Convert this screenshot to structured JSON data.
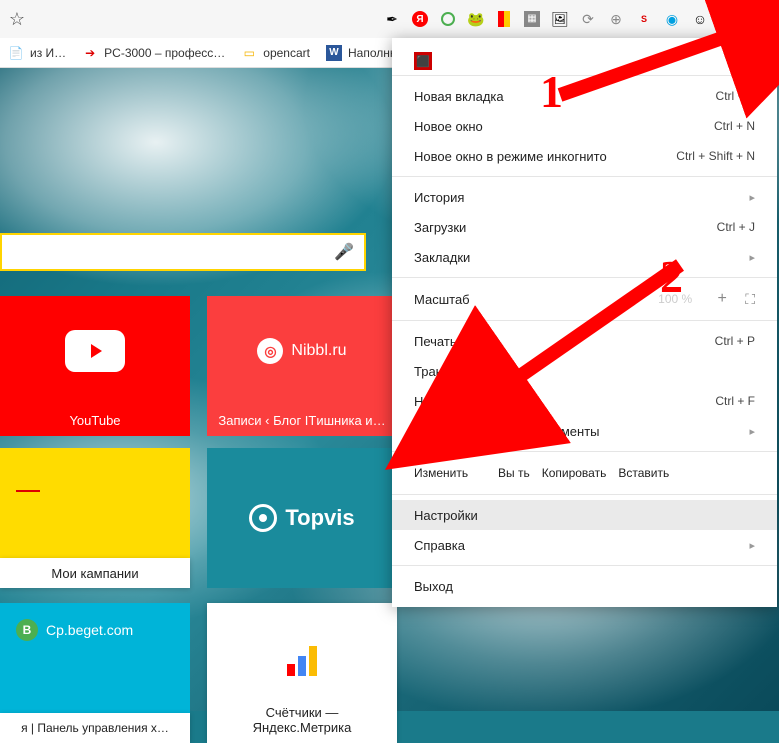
{
  "bookmarks": [
    {
      "label": "из И…"
    },
    {
      "label": "PC-3000 – професс…"
    },
    {
      "label": "opencart"
    },
    {
      "label": "Наполню"
    }
  ],
  "menu": {
    "new_tab": {
      "label": "Новая вкладка",
      "shortcut": "Ctrl + T"
    },
    "new_window": {
      "label": "Новое окно",
      "shortcut": "Ctrl + N"
    },
    "incognito": {
      "label": "Новое окно в режиме инкогнито",
      "shortcut": "Ctrl + Shift + N"
    },
    "history": {
      "label": "История"
    },
    "downloads": {
      "label": "Загрузки",
      "shortcut": "Ctrl + J"
    },
    "bookmarks": {
      "label": "Закладки"
    },
    "zoom": {
      "label": "Масштаб",
      "value": "100 %"
    },
    "print": {
      "label": "Печать...",
      "shortcut": "Ctrl + P"
    },
    "cast": {
      "label": "Трансляция..."
    },
    "find": {
      "label": "Найти...",
      "shortcut": "Ctrl + F"
    },
    "more_tools": {
      "label": "Дополнительные инструменты"
    },
    "edit": {
      "label": "Изменить",
      "cut": "Вы         ть",
      "copy": "Копировать",
      "paste": "Вставить"
    },
    "settings": {
      "label": "Настройки"
    },
    "help": {
      "label": "Справка"
    },
    "exit": {
      "label": "Выход"
    }
  },
  "tiles": {
    "youtube": "YouTube",
    "nibbl": "Nibbl.ru",
    "nibbl_sub": "Записи ‹ Блог ITишника и…",
    "topvisor": "Topvis",
    "campaigns": "Мои кампании",
    "beget": "Cp.beget.com",
    "beget_sub": "я | Панель управления х…",
    "metrika": "Счётчики — Яндекс.Метрика"
  },
  "annot": {
    "one": "1",
    "two": "2"
  }
}
